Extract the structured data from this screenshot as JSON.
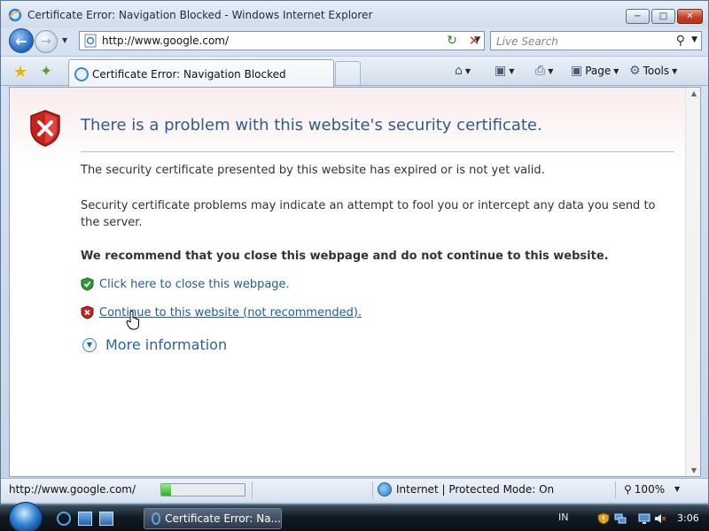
{
  "window": {
    "title": "Certificate Error: Navigation Blocked - Windows Internet Explorer",
    "minimize_label": "−",
    "maximize_label": "□",
    "close_label": "✕"
  },
  "navbar": {
    "address_url": "http://www.google.com/",
    "search_placeholder": "Live Search"
  },
  "tabs": [
    {
      "label": "Certificate Error: Navigation Blocked"
    }
  ],
  "command_bar": {
    "page_label": "Page",
    "tools_label": "Tools"
  },
  "content": {
    "heading": "There is a problem with this website's security certificate.",
    "paragraph1": "The security certificate presented by this website has expired or is not yet valid.",
    "paragraph2": "Security certificate problems may indicate an attempt to fool you or intercept any data you send to the server.",
    "recommendation": "We recommend that you close this webpage and do not continue to this website.",
    "close_link": "Click here to close this webpage.",
    "continue_link": "Continue to this website (not recommended).",
    "more_info": "More information"
  },
  "statusbar": {
    "url": "http://www.google.com/",
    "progress_fraction": 0.12,
    "zone": "Internet | Protected Mode: On",
    "zoom": "100%"
  },
  "taskbar": {
    "task_label": "Certificate Error: Na...",
    "language": "IN",
    "clock": "3:06"
  },
  "icons": {
    "security_shield": "shield-x-icon",
    "close_shield": "shield-check-icon",
    "continue_shield": "shield-x-small-icon"
  },
  "colors": {
    "heading": "#2f5b8e",
    "link": "#1f5c9c",
    "shield_red": "#c8201a",
    "shield_green": "#2f9a2f"
  }
}
